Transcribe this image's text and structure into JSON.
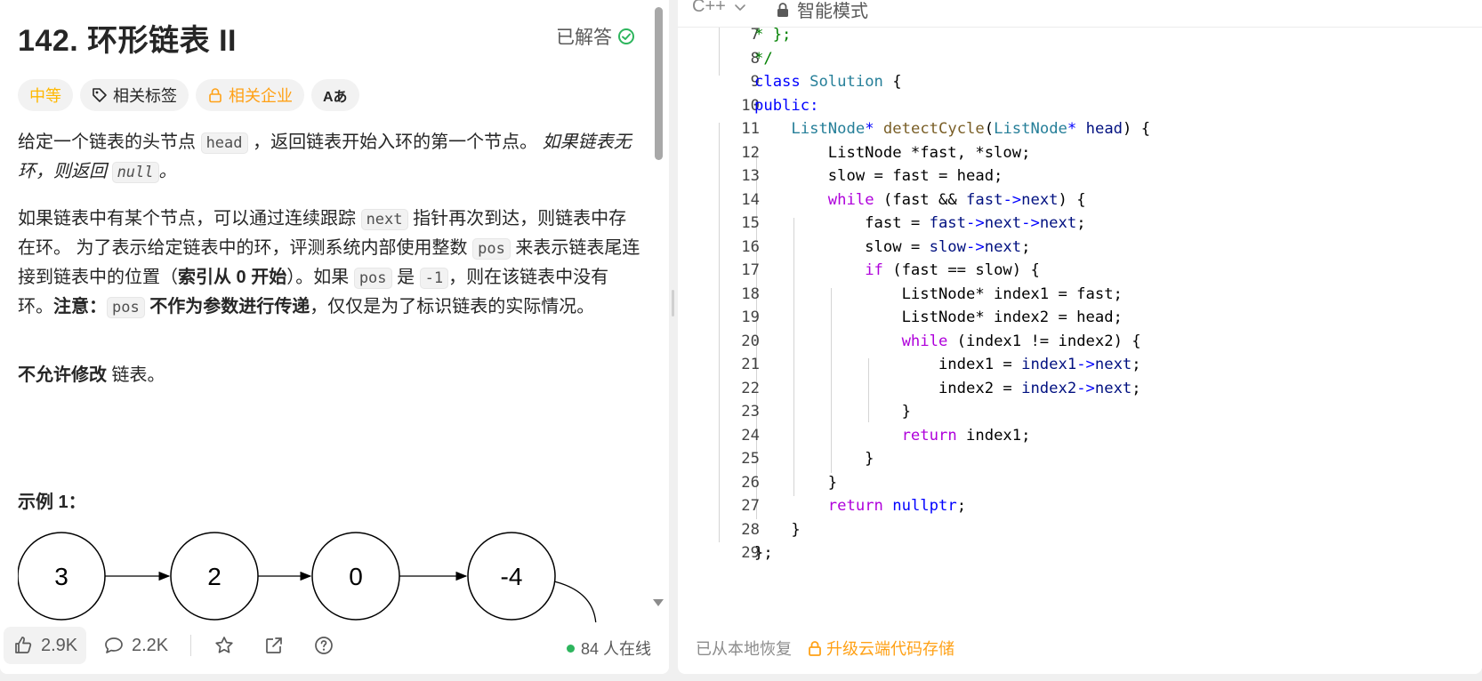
{
  "problem": {
    "title": "142. 环形链表 II",
    "status": "已解答",
    "tags": {
      "difficulty": "中等",
      "related_tags": "相关标签",
      "related_companies": "相关企业",
      "translate": "Aあ"
    },
    "p1": {
      "t1": "给定一个链表的头节点 ",
      "c1": "head",
      "t2": " ，返回链表开始入环的第一个节点。 ",
      "e1": "如果链表无环，则返回 ",
      "c2": "null",
      "e2": "。"
    },
    "p2": {
      "t1": "如果链表中有某个节点，可以通过连续跟踪 ",
      "c1": "next",
      "t2": " 指针再次到达，则链表中存在环。 为了表示给定链表中的环，评测系统内部使用整数 ",
      "c2": "pos",
      "t3": " 来表示链表尾连接到链表中的位置（",
      "b1": "索引从 0 开始",
      "t4": "）。如果 ",
      "c3": "pos",
      "t5": " 是 ",
      "c4": "-1",
      "t6": "，则在该链表中没有环。",
      "b2": "注意：",
      "c5": "pos",
      "b3": " 不作为参数进行传递",
      "t7": "，仅仅是为了标识链表的实际情况。"
    },
    "p3": {
      "b1": "不允许修改",
      "t1": " 链表。"
    },
    "example_title": "示例 1：",
    "diagram_nodes": [
      "3",
      "2",
      "0",
      "-4"
    ]
  },
  "footer": {
    "likes": "2.9K",
    "comments": "2.2K",
    "online": "84 人在线"
  },
  "editor": {
    "language": "C++",
    "mode": "智能模式",
    "restore_status": "已从本地恢复",
    "upgrade": "升级云端代码存储",
    "line_numbers": [
      "7",
      "8",
      "9",
      "10",
      "11",
      "12",
      "13",
      "14",
      "15",
      "16",
      "17",
      "18",
      "19",
      "20",
      "21",
      "22",
      "23",
      "24",
      "25",
      "26",
      "27",
      "28",
      "29"
    ]
  },
  "colors": {
    "accent_orange": "#ffa116",
    "difficulty_medium": "#ffb800",
    "solved_green": "#2db55d",
    "keyword_blue": "#0000ff",
    "keyword_purple": "#af00db",
    "type_teal": "#267f99",
    "function_brown": "#795e26",
    "comment_green": "#008000"
  }
}
